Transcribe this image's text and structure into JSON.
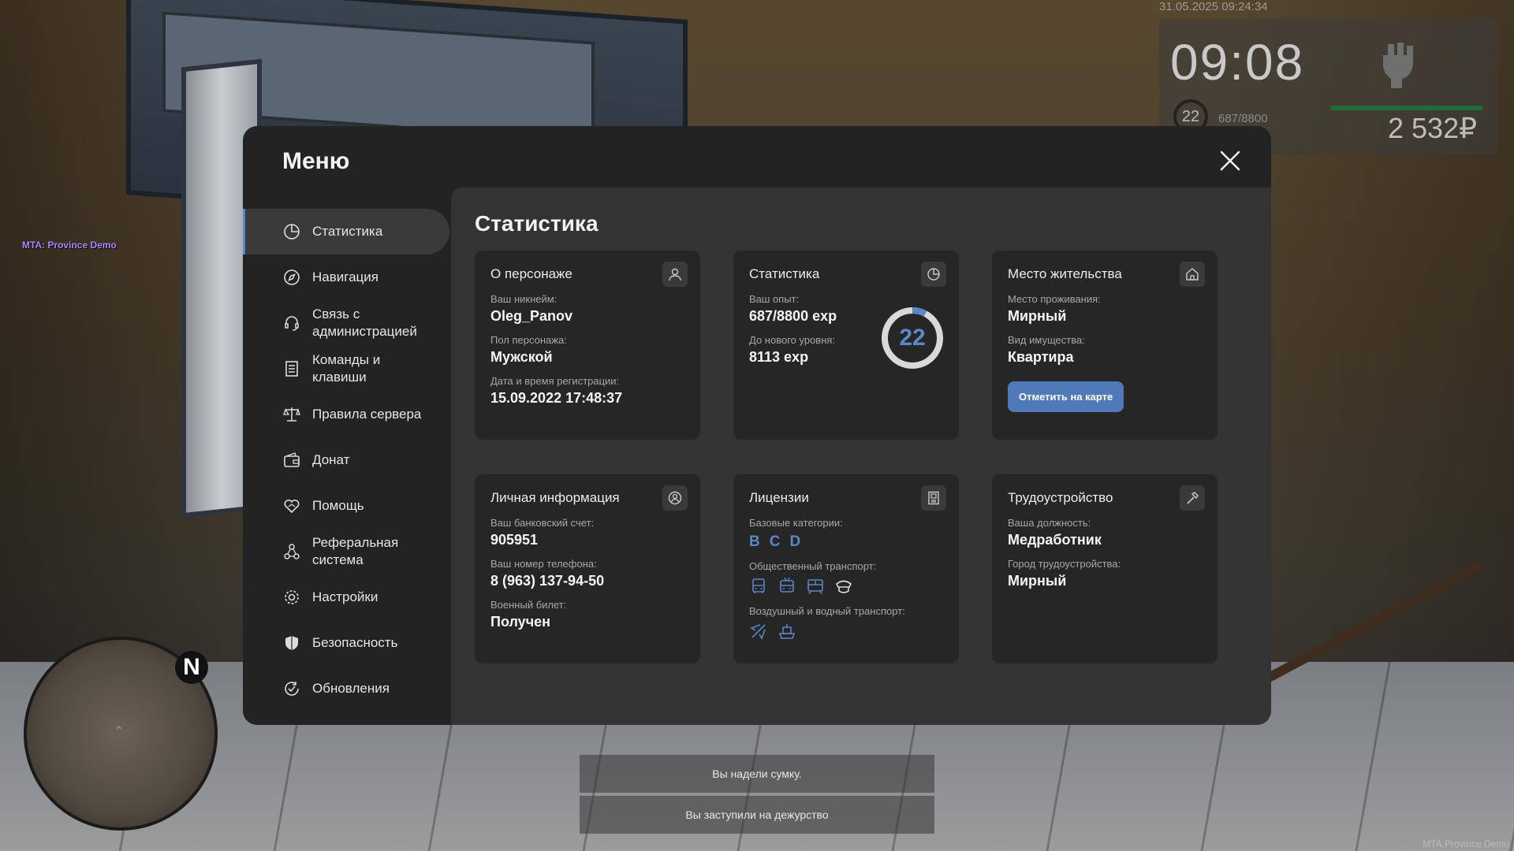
{
  "hud": {
    "datetime": "31.05.2025 09:24:34",
    "time": "09:08",
    "level": "22",
    "exp": "687/8800",
    "money": "2 532₽",
    "hp_fraction": 1.0
  },
  "overlay": {
    "mta_label": "MTA: Province Demo",
    "mta_bottom": "MTA:Province Demo"
  },
  "notifications": [
    "Вы надели сумку.",
    "Вы заступили на дежурство"
  ],
  "menu": {
    "title": "Меню",
    "sidebar": [
      {
        "label": "Статистика",
        "icon": "pie-chart-icon",
        "active": true
      },
      {
        "label": "Навигация",
        "icon": "compass-icon"
      },
      {
        "label": "Связь с администрацией",
        "icon": "headset-icon"
      },
      {
        "label": "Команды и клавиши",
        "icon": "document-list-icon"
      },
      {
        "label": "Правила сервера",
        "icon": "scales-icon"
      },
      {
        "label": "Донат",
        "icon": "wallet-icon"
      },
      {
        "label": "Помощь",
        "icon": "handshake-icon"
      },
      {
        "label": "Реферальная система",
        "icon": "network-icon"
      },
      {
        "label": "Настройки",
        "icon": "gear-icon"
      },
      {
        "label": "Безопасность",
        "icon": "shield-icon"
      },
      {
        "label": "Обновления",
        "icon": "refresh-check-icon"
      }
    ],
    "section_title": "Статистика",
    "cards": {
      "persona": {
        "title": "О персонаже",
        "nick_label": "Ваш никнейм:",
        "nick": "Oleg_Panov",
        "gender_label": "Пол персонажа:",
        "gender": "Мужской",
        "reg_label": "Дата и время регистрации:",
        "reg": "15.09.2022 17:48:37"
      },
      "stats": {
        "title": "Статистика",
        "exp_label": "Ваш опыт:",
        "exp": "687/8800 exp",
        "next_label": "До нового уровня:",
        "next": "8113 exp",
        "level": "22",
        "level_progress": 0.078
      },
      "residence": {
        "title": "Место жительства",
        "place_label": "Место проживания:",
        "place": "Мирный",
        "property_label": "Вид имущества:",
        "property": "Квартира",
        "button": "Отметить на карте"
      },
      "personal": {
        "title": "Личная информация",
        "bank_label": "Ваш банковский счет:",
        "bank": "905951",
        "phone_label": "Ваш номер телефона:",
        "phone": "8 (963) 137-94-50",
        "military_label": "Военный билет:",
        "military": "Получен"
      },
      "licenses": {
        "title": "Лицензии",
        "base_label": "Базовые категории:",
        "base": [
          "B",
          "C",
          "D"
        ],
        "public_label": "Общественный транспорт:",
        "air_label": "Воздушный и водный транспорт:"
      },
      "job": {
        "title": "Трудоустройство",
        "post_label": "Ваша должность:",
        "post": "Медработник",
        "city_label": "Город трудоустройства:",
        "city": "Мирный"
      }
    }
  }
}
